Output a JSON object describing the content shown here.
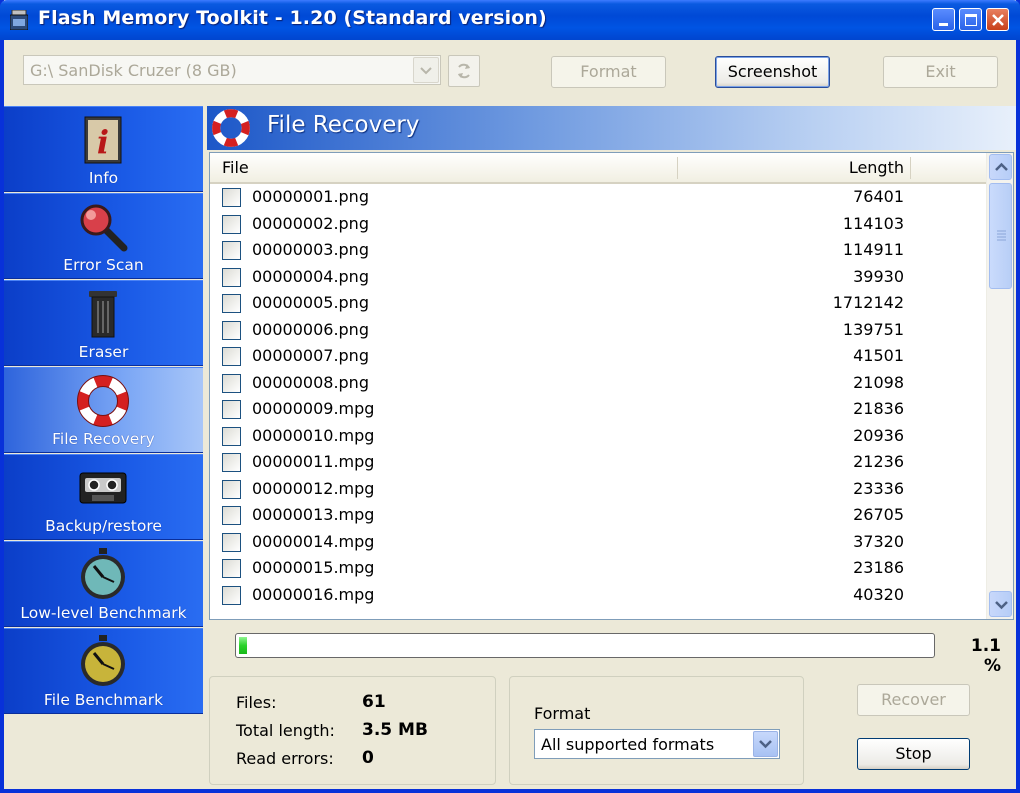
{
  "window": {
    "title": "Flash Memory Toolkit - 1.20 (Standard version)"
  },
  "toolbar": {
    "drive": "G:\\ SanDisk Cruzer (8 GB)",
    "format_label": "Format",
    "screenshot_label": "Screenshot",
    "exit_label": "Exit"
  },
  "sidebar": {
    "items": [
      {
        "label": "Info",
        "icon": "info-icon"
      },
      {
        "label": "Error Scan",
        "icon": "magnifier-icon"
      },
      {
        "label": "Eraser",
        "icon": "trash-icon"
      },
      {
        "label": "File Recovery",
        "icon": "lifebuoy-icon",
        "active": true
      },
      {
        "label": "Backup/restore",
        "icon": "cassette-icon"
      },
      {
        "label": "Low-level Benchmark",
        "icon": "stopwatch-icon"
      },
      {
        "label": "File Benchmark",
        "icon": "stopwatch-icon"
      }
    ]
  },
  "main": {
    "title": "File Recovery",
    "columns": {
      "file": "File",
      "length": "Length"
    },
    "rows": [
      {
        "name": "00000001.png",
        "length": "76401"
      },
      {
        "name": "00000002.png",
        "length": "114103"
      },
      {
        "name": "00000003.png",
        "length": "114911"
      },
      {
        "name": "00000004.png",
        "length": "39930"
      },
      {
        "name": "00000005.png",
        "length": "1712142"
      },
      {
        "name": "00000006.png",
        "length": "139751"
      },
      {
        "name": "00000007.png",
        "length": "41501"
      },
      {
        "name": "00000008.png",
        "length": "21098"
      },
      {
        "name": "00000009.mpg",
        "length": "21836"
      },
      {
        "name": "00000010.mpg",
        "length": "20936"
      },
      {
        "name": "00000011.mpg",
        "length": "21236"
      },
      {
        "name": "00000012.mpg",
        "length": "23336"
      },
      {
        "name": "00000013.mpg",
        "length": "26705"
      },
      {
        "name": "00000014.mpg",
        "length": "37320"
      },
      {
        "name": "00000015.mpg",
        "length": "23186"
      },
      {
        "name": "00000016.mpg",
        "length": "40320"
      }
    ],
    "progress": {
      "value": 1.1,
      "text": "1.1 %"
    },
    "stats": {
      "files_label": "Files:",
      "files_value": "61",
      "total_label": "Total length:",
      "total_value": "3.5 MB",
      "errors_label": "Read errors:",
      "errors_value": "0"
    },
    "format": {
      "label": "Format",
      "selected": "All supported formats"
    },
    "recover_label": "Recover",
    "stop_label": "Stop"
  }
}
